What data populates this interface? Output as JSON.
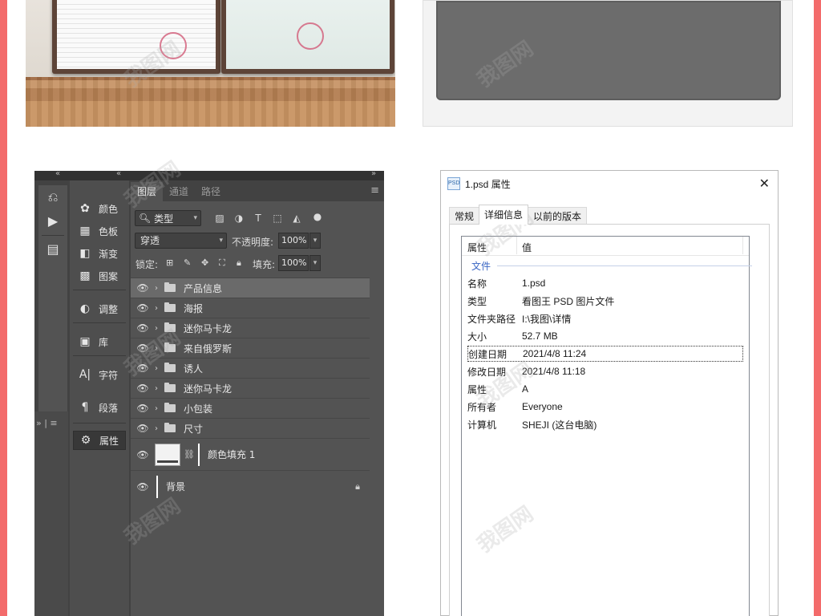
{
  "watermark": "我图网",
  "colors": {
    "side_bar": "#f36b6b",
    "ps_panel": "#535353",
    "ps_dark": "#424242",
    "dialog_group": "#3a66c4"
  },
  "photoshop": {
    "panels": [
      {
        "icon": "palette-icon",
        "label": "颜色"
      },
      {
        "icon": "swatches-icon",
        "label": "色板"
      },
      {
        "icon": "gradient-icon",
        "label": "渐变"
      },
      {
        "icon": "patterns-icon",
        "label": "图案"
      },
      {
        "icon": "adjustments-icon",
        "label": "调整"
      },
      {
        "icon": "libraries-icon",
        "label": "库"
      },
      {
        "icon": "character-icon",
        "label": "字符"
      },
      {
        "icon": "paragraph-icon",
        "label": "段落"
      },
      {
        "icon": "properties-icon",
        "label": "属性"
      }
    ],
    "tabs": [
      "图层",
      "通道",
      "路径"
    ],
    "filter_kind": "类型",
    "blend_mode": "穿透",
    "opacity_label": "不透明度:",
    "opacity_value": "100%",
    "lock_label": "锁定:",
    "fill_label": "填充:",
    "fill_value": "100%",
    "layers": [
      {
        "name": "产品信息",
        "type": "group",
        "selected": true
      },
      {
        "name": "海报",
        "type": "group"
      },
      {
        "name": "迷你马卡龙",
        "type": "group"
      },
      {
        "name": "来自俄罗斯",
        "type": "group"
      },
      {
        "name": "诱人",
        "type": "group"
      },
      {
        "name": "迷你马卡龙",
        "type": "group"
      },
      {
        "name": "小包装",
        "type": "group"
      },
      {
        "name": "尺寸",
        "type": "group"
      }
    ],
    "fill_layer": "颜色填充 1",
    "background_layer": "背景"
  },
  "dialog": {
    "title": "1.psd 属性",
    "tabs": [
      "常规",
      "详细信息",
      "以前的版本"
    ],
    "active_tab": "详细信息",
    "col_property": "属性",
    "col_value": "值",
    "group": "文件",
    "rows": [
      {
        "k": "名称",
        "v": "1.psd"
      },
      {
        "k": "类型",
        "v": "看图王 PSD 图片文件"
      },
      {
        "k": "文件夹路径",
        "v": "I:\\我图\\详情"
      },
      {
        "k": "大小",
        "v": "52.7 MB"
      },
      {
        "k": "创建日期",
        "v": "2021/4/8 11:24"
      },
      {
        "k": "修改日期",
        "v": "2021/4/8 11:18"
      },
      {
        "k": "属性",
        "v": "A"
      },
      {
        "k": "所有者",
        "v": "Everyone"
      },
      {
        "k": "计算机",
        "v": "SHEJI (这台电脑)"
      }
    ]
  }
}
